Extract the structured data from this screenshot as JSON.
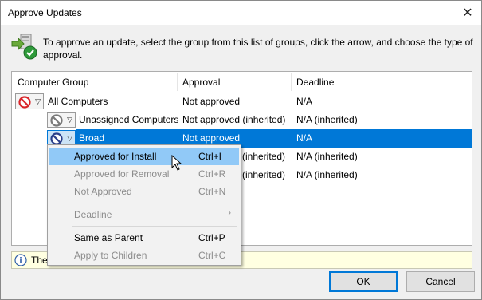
{
  "window": {
    "title": "Approve Updates",
    "close_glyph": "✕"
  },
  "instructions": "To approve an update, select the group from this list of groups, click the arrow, and choose the type of approval.",
  "grid": {
    "columns": [
      "Computer Group",
      "Approval",
      "Deadline"
    ],
    "rows": [
      {
        "group": "All Computers",
        "approval": "Not approved",
        "deadline": "N/A",
        "icon": "not-approved-icon"
      },
      {
        "group": "Unassigned Computers",
        "approval": "Not approved (inherited)",
        "deadline": "N/A (inherited)",
        "icon": "inherited-icon"
      },
      {
        "group": "Broad",
        "approval": "Not approved",
        "deadline": "N/A",
        "icon": "not-approved-icon",
        "selected": true
      },
      {
        "group": "",
        "approval": "(inherited)",
        "deadline": "N/A (inherited)"
      },
      {
        "group": "",
        "approval": "(inherited)",
        "deadline": "N/A (inherited)"
      }
    ]
  },
  "context_menu": {
    "items": [
      {
        "label": "Approved for Install",
        "shortcut": "Ctrl+I",
        "enabled": true,
        "hover": true
      },
      {
        "label": "Approved for Removal",
        "shortcut": "Ctrl+R",
        "enabled": false
      },
      {
        "label": "Not Approved",
        "shortcut": "Ctrl+N",
        "enabled": false
      },
      {
        "label": "Deadline",
        "submenu_glyph": "›",
        "enabled": false
      },
      {
        "label": "Same as Parent",
        "shortcut": "Ctrl+P",
        "enabled": true
      },
      {
        "label": "Apply to Children",
        "shortcut": "Ctrl+C",
        "enabled": false
      }
    ]
  },
  "status": {
    "text": "The",
    "icon": "info-icon"
  },
  "buttons": {
    "ok": "OK",
    "cancel": "Cancel"
  },
  "colors": {
    "selection": "#0078d7",
    "menu_hover": "#91c9f7",
    "info_bar": "#ffffe1",
    "no_entry": "#d9262b"
  }
}
